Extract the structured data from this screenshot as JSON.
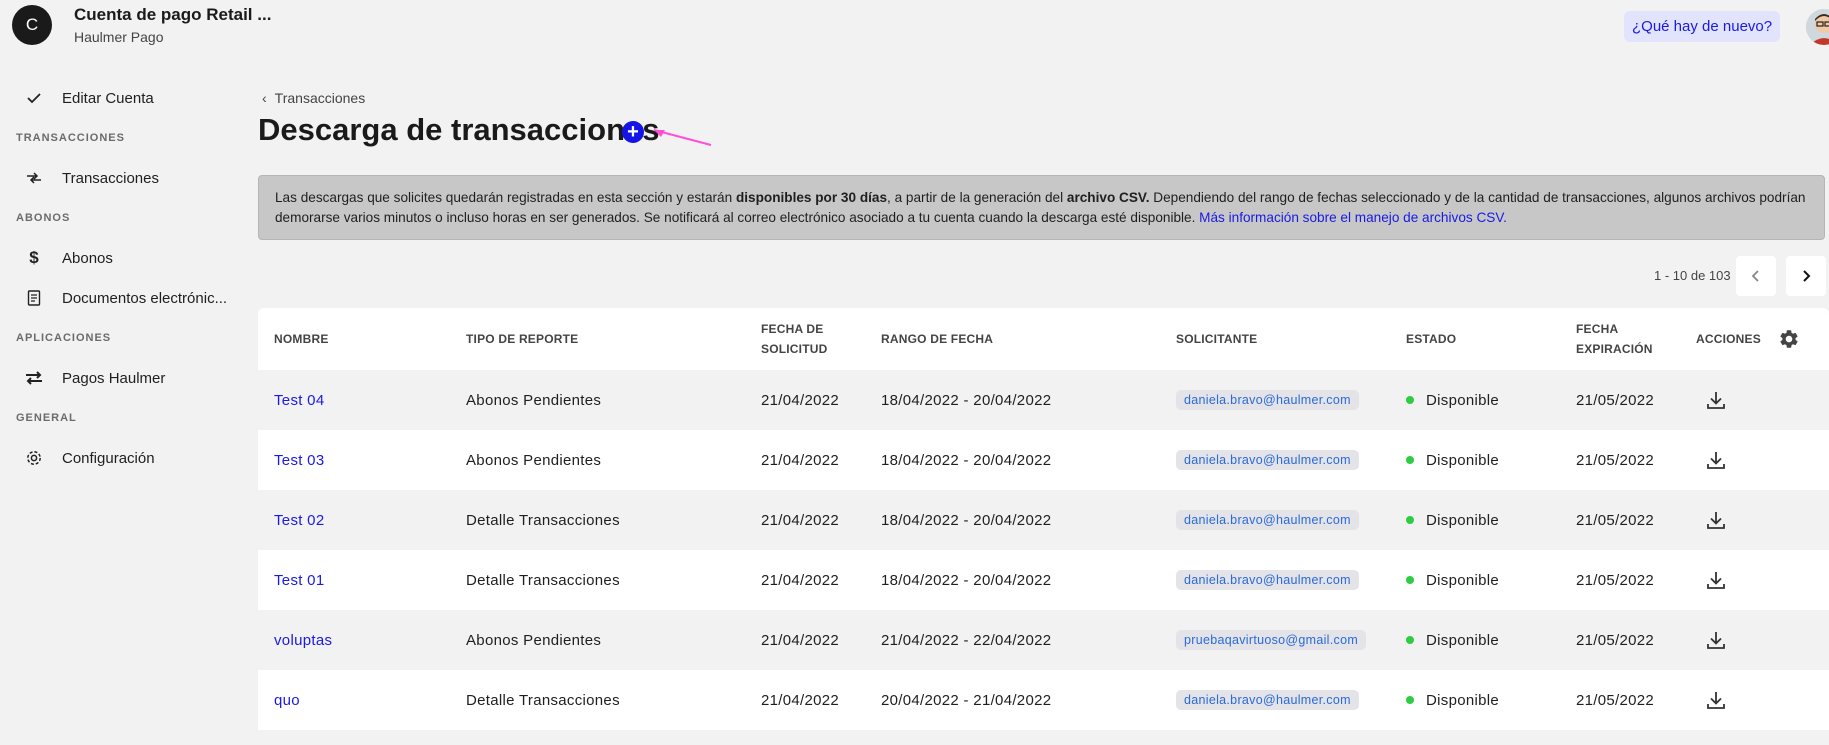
{
  "account": {
    "initial": "C",
    "name": "Cuenta de pago Retail ...",
    "subtitle": "Haulmer Pago"
  },
  "header": {
    "whats_new": "¿Qué hay de nuevo?"
  },
  "sidebar": {
    "items": [
      {
        "label": "Editar Cuenta",
        "icon": "check-icon"
      },
      {
        "section": "TRANSACCIONES"
      },
      {
        "label": "Transacciones",
        "icon": "transactions-icon"
      },
      {
        "section": "ABONOS"
      },
      {
        "label": "Abonos",
        "icon": "dollar-icon"
      },
      {
        "label": "Documentos electrónic...",
        "icon": "receipt-icon"
      },
      {
        "section": "APLICACIONES"
      },
      {
        "label": "Pagos Haulmer",
        "icon": "swap-icon"
      },
      {
        "section": "GENERAL"
      },
      {
        "label": "Configuración",
        "icon": "gear-icon"
      }
    ]
  },
  "breadcrumb": "Transacciones",
  "page_title": "Descarga de transacciones",
  "info": {
    "part1": "Las descargas que solicites quedarán registradas en esta sección y estarán ",
    "bold1": "disponibles por 30 días",
    "part2": ", a partir de la generación del ",
    "bold2": "archivo CSV.",
    "part3": " Dependiendo del rango de fechas seleccionado y de la cantidad de transacciones, algunos archivos podrían demorarse varios minutos o incluso horas en ser generados. Se notificará al correo electrónico asociado a tu cuenta cuando la descarga esté disponible. ",
    "link": "Más información sobre el manejo de archivos CSV."
  },
  "pagination": {
    "text": "1 - 10 de 103"
  },
  "table": {
    "headers": {
      "nombre": "NOMBRE",
      "tipo": "TIPO DE REPORTE",
      "fecha_solicitud_1": "FECHA DE",
      "fecha_solicitud_2": "SOLICITUD",
      "rango": "RANGO DE FECHA",
      "solicitante": "SOLICITANTE",
      "estado": "ESTADO",
      "expiracion_1": "FECHA",
      "expiracion_2": "EXPIRACIÓN",
      "acciones": "ACCIONES"
    },
    "rows": [
      {
        "nombre": "Test 04",
        "tipo": "Abonos Pendientes",
        "fecha": "21/04/2022",
        "rango": "18/04/2022 - 20/04/2022",
        "solicitante": "daniela.bravo@haulmer.com",
        "estado": "Disponible",
        "expiracion": "21/05/2022"
      },
      {
        "nombre": "Test 03",
        "tipo": "Abonos Pendientes",
        "fecha": "21/04/2022",
        "rango": "18/04/2022 - 20/04/2022",
        "solicitante": "daniela.bravo@haulmer.com",
        "estado": "Disponible",
        "expiracion": "21/05/2022"
      },
      {
        "nombre": "Test 02",
        "tipo": "Detalle Transacciones",
        "fecha": "21/04/2022",
        "rango": "18/04/2022 - 20/04/2022",
        "solicitante": "daniela.bravo@haulmer.com",
        "estado": "Disponible",
        "expiracion": "21/05/2022"
      },
      {
        "nombre": "Test 01",
        "tipo": "Detalle Transacciones",
        "fecha": "21/04/2022",
        "rango": "18/04/2022 - 20/04/2022",
        "solicitante": "daniela.bravo@haulmer.com",
        "estado": "Disponible",
        "expiracion": "21/05/2022"
      },
      {
        "nombre": "voluptas",
        "tipo": "Abonos Pendientes",
        "fecha": "21/04/2022",
        "rango": "21/04/2022 - 22/04/2022",
        "solicitante": "pruebaqavirtuoso@gmail.com",
        "estado": "Disponible",
        "expiracion": "21/05/2022"
      },
      {
        "nombre": "quo",
        "tipo": "Detalle Transacciones",
        "fecha": "21/04/2022",
        "rango": "20/04/2022 - 21/04/2022",
        "solicitante": "daniela.bravo@haulmer.com",
        "estado": "Disponible",
        "expiracion": "21/05/2022"
      }
    ]
  },
  "colors": {
    "accent": "#1414e6",
    "link": "#1a1ae6",
    "status_ok": "#2ecc40",
    "annotation_arrow": "#ff4fd8"
  }
}
